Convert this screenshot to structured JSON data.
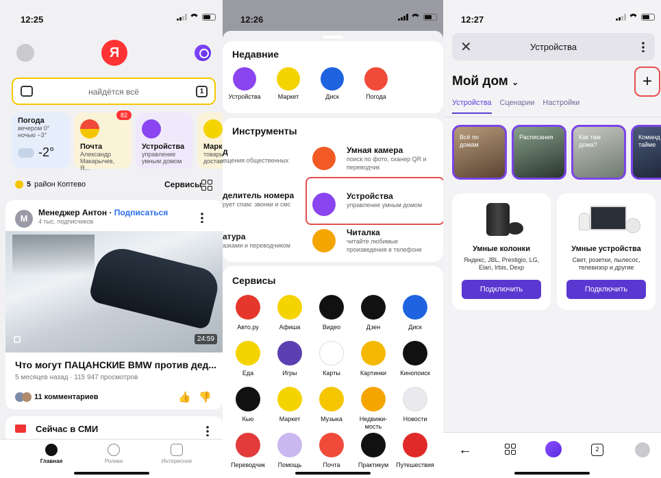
{
  "panel1": {
    "time": "12:25",
    "logo": "Я",
    "search_placeholder": "найдётся всё",
    "search_badge": "1",
    "weather": {
      "title": "Погода",
      "sub1": "вечером 0°",
      "sub2": "ночью −3°",
      "temp": "-2°"
    },
    "mail": {
      "title": "Почта",
      "sub": "Александр Макарычев, Я...",
      "badge": "82"
    },
    "devices": {
      "title": "Устройства",
      "sub": "управление умным домом"
    },
    "market": {
      "title": "Марке",
      "sub": "товары доставк"
    },
    "location": {
      "coins": "5",
      "district": "район Коптево"
    },
    "services_label": "Сервисы",
    "post": {
      "avatar_letter": "M",
      "author": "Менеджер Антон",
      "separator": "·",
      "subscribe": "Подписаться",
      "followers": "4 тыс. подписчиков",
      "duration": "24:59",
      "title": "Что могут ПАЦАНСКИЕ BMW против дед...",
      "meta": "5 месяцев назад · 115 947 просмотров",
      "comments": "11 комментариев"
    },
    "news_title": "Сейчас в СМИ",
    "tabbar": [
      {
        "label": "Главная",
        "icon": "yandex-icon"
      },
      {
        "label": "Ролики",
        "icon": "play-icon"
      },
      {
        "label": "Интересное",
        "icon": "sparkle-icon"
      }
    ]
  },
  "panel2": {
    "time": "12:26",
    "recent_title": "Недавние",
    "recent": [
      {
        "label": "Устройства",
        "color": "#8b45f0"
      },
      {
        "label": "Маркет",
        "color": "#f5d300"
      },
      {
        "label": "Диск",
        "color": "#1f63e0"
      },
      {
        "label": "Погода",
        "color": "#f04a3a"
      }
    ],
    "tools_title": "Инструменты",
    "tools": [
      {
        "title": "д",
        "sub": "ещения общественных"
      },
      {
        "title": "Умная камера",
        "sub": "поиск по фото, сканер QR и переводчик"
      },
      {
        "title": "делитель номера",
        "sub": "рует спам: звонки и смс"
      },
      {
        "title": "Устройства",
        "sub": "управление умным домом"
      },
      {
        "title": "атура",
        "sub": "азками и переводчиком"
      },
      {
        "title": "Читалка",
        "sub": "читайте любимые произведения в телефоне"
      }
    ],
    "services_title": "Сервисы",
    "services": [
      {
        "label": "Авто.ру",
        "color": "#e5372b"
      },
      {
        "label": "Афиша",
        "color": "#f5d300"
      },
      {
        "label": "Видео",
        "color": "#111111"
      },
      {
        "label": "Дзен",
        "color": "#111111"
      },
      {
        "label": "Диск",
        "color": "#1f63e0"
      },
      {
        "label": "Еда",
        "color": "#f5d300"
      },
      {
        "label": "Игры",
        "color": "#5b3fb0"
      },
      {
        "label": "Карты",
        "color": "#ffffff"
      },
      {
        "label": "Картинки",
        "color": "#f5b800"
      },
      {
        "label": "Кинопоиск",
        "color": "#111111"
      },
      {
        "label": "Кью",
        "color": "#111111"
      },
      {
        "label": "Маркет",
        "color": "#f5d300"
      },
      {
        "label": "Музыка",
        "color": "#f5c600"
      },
      {
        "label": "Недвижи-мость",
        "color": "#f5a500"
      },
      {
        "label": "Новости",
        "color": "#e9e9ee"
      },
      {
        "label": "Переводчик",
        "color": "#e33b3b"
      },
      {
        "label": "Помощь",
        "color": "#c9b8f0"
      },
      {
        "label": "Почта",
        "color": "#f04a3a"
      },
      {
        "label": "Практикум",
        "color": "#111111"
      },
      {
        "label": "Путешествия",
        "color": "#e02a2a"
      }
    ]
  },
  "panel3": {
    "time": "12:27",
    "title": "Устройства",
    "home": "Мой дом",
    "tabs": [
      "Устройства",
      "Сценарии",
      "Настройки"
    ],
    "stories": [
      "Всё по домам",
      "Расписания",
      "Как там дома?",
      "Команд с тайме"
    ],
    "cards": [
      {
        "title": "Умные колонки",
        "sub": "Яндекс, JBL, Prestigio, LG, Elari, Irbis, Dexp",
        "button": "Подключить"
      },
      {
        "title": "Умные устройства",
        "sub": "Свет, розетки, пылесос, телевизор и другие",
        "button": "Подключить"
      }
    ],
    "tab_badge": "2"
  }
}
